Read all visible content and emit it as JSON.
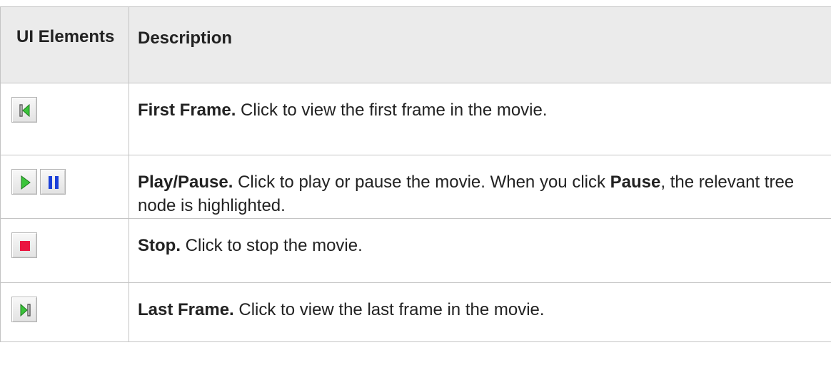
{
  "table": {
    "headers": {
      "ui": "UI Elements",
      "description": "Description"
    },
    "rows": [
      {
        "icons": [
          "first-frame-icon"
        ],
        "title": "First Frame.",
        "text": " Click to view the first frame in the movie."
      },
      {
        "icons": [
          "play-icon",
          "pause-icon"
        ],
        "title": "Play/Pause.",
        "text": " Click to play or pause the movie. When you click ",
        "bold2": "Pause",
        "text2": ", the relevant tree node is highlighted."
      },
      {
        "icons": [
          "stop-icon"
        ],
        "title": "Stop.",
        "text": " Click to stop the movie."
      },
      {
        "icons": [
          "last-frame-icon"
        ],
        "title": "Last Frame.",
        "text": " Click to view the last frame in the movie."
      }
    ]
  },
  "colors": {
    "header_bg": "#ebebeb",
    "border": "#c4c4c4",
    "icon_green": "#3ac43a",
    "icon_blue": "#1a3fd8",
    "icon_red": "#ea1540"
  }
}
